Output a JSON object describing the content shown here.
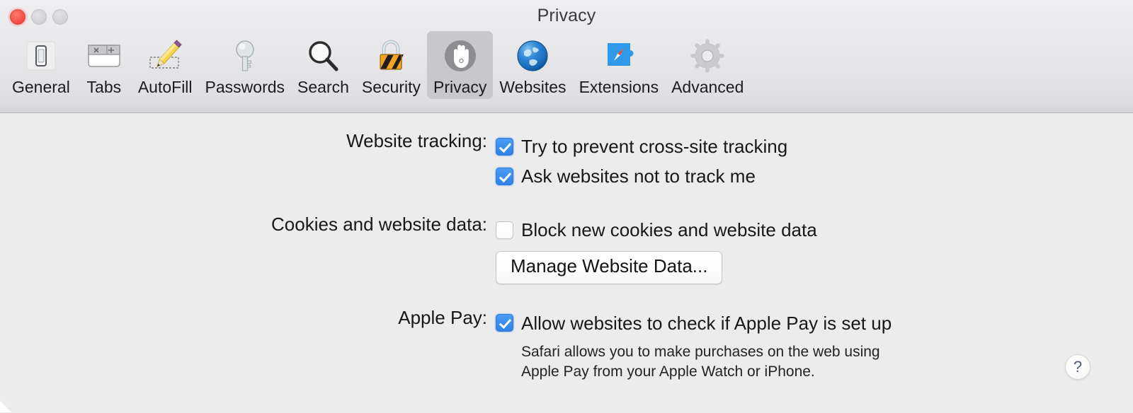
{
  "window": {
    "title": "Privacy",
    "traffic_lights": [
      {
        "name": "close",
        "color": "#f5544a",
        "active": true
      },
      {
        "name": "minimize",
        "color": "#d4d4d6",
        "active": false
      },
      {
        "name": "zoom",
        "color": "#d4d4d6",
        "active": false
      }
    ]
  },
  "toolbar": {
    "selected": "Privacy",
    "tabs": [
      {
        "label": "General",
        "icon": "general-icon"
      },
      {
        "label": "Tabs",
        "icon": "tabs-icon"
      },
      {
        "label": "AutoFill",
        "icon": "autofill-pencil-icon"
      },
      {
        "label": "Passwords",
        "icon": "key-icon"
      },
      {
        "label": "Search",
        "icon": "magnifier-icon"
      },
      {
        "label": "Security",
        "icon": "padlock-icon"
      },
      {
        "label": "Privacy",
        "icon": "hand-icon"
      },
      {
        "label": "Websites",
        "icon": "globe-icon"
      },
      {
        "label": "Extensions",
        "icon": "puzzle-compass-icon"
      },
      {
        "label": "Advanced",
        "icon": "gear-icon"
      }
    ]
  },
  "settings": {
    "website_tracking": {
      "label": "Website tracking:",
      "options": [
        {
          "text": "Try to prevent cross-site tracking",
          "checked": true
        },
        {
          "text": "Ask websites not to track me",
          "checked": true
        }
      ]
    },
    "cookies": {
      "label": "Cookies and website data:",
      "options": [
        {
          "text": "Block new cookies and website data",
          "checked": false
        }
      ],
      "button": "Manage Website Data..."
    },
    "apple_pay": {
      "label": "Apple Pay:",
      "options": [
        {
          "text": "Allow websites to check if Apple Pay is set up",
          "checked": true
        }
      ],
      "description": "Safari allows you to make purchases on the web using\nApple Pay from your Apple Watch or iPhone."
    }
  },
  "help": {
    "glyph": "?"
  },
  "colors": {
    "accent_checkbox": "#3b8ef0",
    "toolbar_bg": "#e8e8ea",
    "content_bg": "#ececec",
    "selected_tab_bg": "#c8c8cb"
  }
}
